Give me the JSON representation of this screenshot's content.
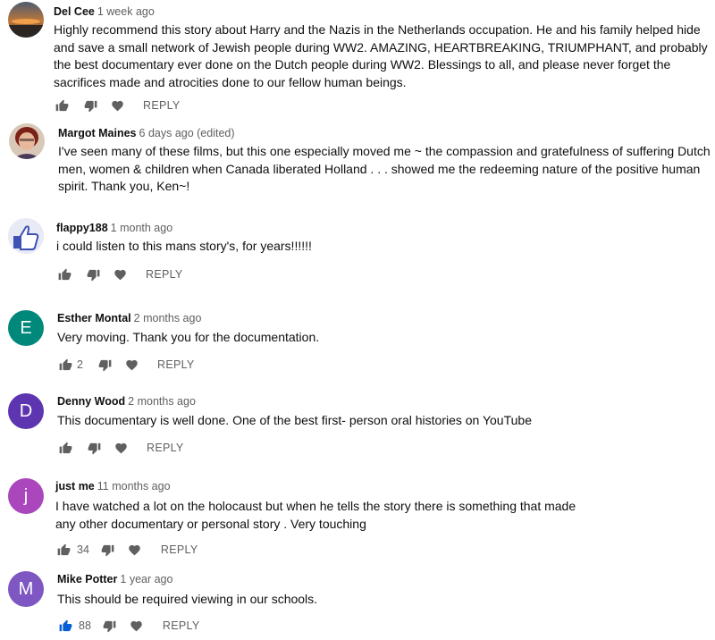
{
  "ui": {
    "reply_label": "REPLY",
    "colors": {
      "icon_gray": "#606060",
      "liked_blue": "#065fd4"
    }
  },
  "comments": [
    {
      "author": "Del Cee",
      "time": "1 week ago",
      "text": "Highly recommend this story about Harry and the Nazis in the Netherlands occupation. He and his family helped hide and save a small network of Jewish people during WW2. AMAZING, HEARTBREAKING, TRIUMPHANT, and probably the best documentary ever done on the Dutch people during WW2. Blessings to all, and please never forget the sacrifices made and atrocities done to our fellow human beings.",
      "likes": "",
      "avatar": "photo-sunset"
    },
    {
      "author": "Margot Maines",
      "time": "6 days ago (edited)",
      "text": "I've seen many of these films, but this one especially moved me ~ the compassion and gratefulness of suffering Dutch men, women & children when Canada liberated Holland . . . showed me the redeeming nature of the positive human spirit. Thank you, Ken~!",
      "likes": "",
      "avatar": "photo-woman"
    },
    {
      "author": "flappy188",
      "time": "1 month ago",
      "text": "i could listen to this mans story's, for years!!!!!!",
      "likes": "",
      "avatar": "thumbs-up-cartoon"
    },
    {
      "author": "Esther Montal",
      "time": "2 months ago",
      "text": "Very moving. Thank you for the documentation.",
      "likes": "2",
      "avatar_letter": "E",
      "avatar_color": "#00897b"
    },
    {
      "author": "Denny Wood",
      "time": "2 months ago",
      "text": "This documentary is well done. One of the best first- person oral histories on YouTube",
      "likes": "",
      "avatar_letter": "D",
      "avatar_color": "#5e35b1"
    },
    {
      "author": "just me",
      "time": "11 months ago",
      "text_lines": [
        "I have watched a lot on the holocaust but when he tells the story there is something that made",
        "any other documentary or personal story .  Very touching"
      ],
      "likes": "34",
      "avatar_letter": "j",
      "avatar_color": "#ab47bc"
    },
    {
      "author": "Mike Potter",
      "time": "1 year ago",
      "text": "This should be required viewing in our schools.",
      "likes": "88",
      "liked": true,
      "avatar_letter": "M",
      "avatar_color": "#7e57c2"
    }
  ]
}
